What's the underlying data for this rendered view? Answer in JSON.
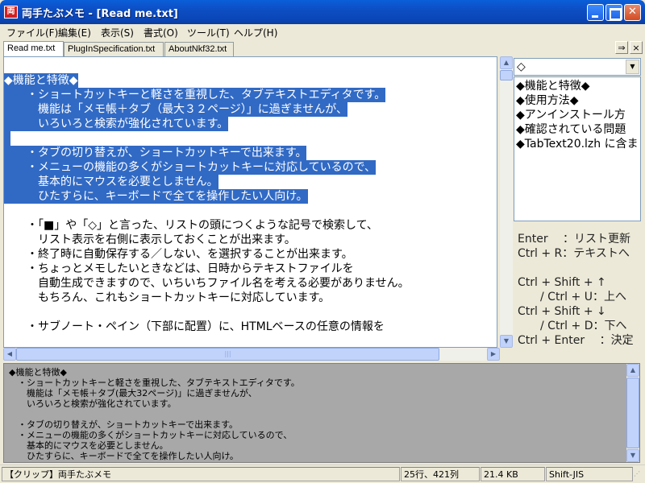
{
  "window": {
    "title": "両手たぶメモ - [Read me.txt]",
    "icon_text": "両"
  },
  "menu": [
    "ファイル(F)",
    "編集(E)",
    "表示(S)",
    "書式(O)",
    "ツール(T)",
    "ヘルプ(H)"
  ],
  "tabs": [
    {
      "label": "Read me.txt",
      "active": true
    },
    {
      "label": "PlugInSpecification.txt",
      "active": false
    },
    {
      "label": "AboutNkf32.txt",
      "active": false
    }
  ],
  "tab_nav": {
    "right": "⇒",
    "close": "×"
  },
  "editor": {
    "lines": [
      {
        "text": "◆機能と特徴◆",
        "selected": true
      },
      {
        "text": "　　・ショートカットキーと軽さを重視した、タブテキストエディタです。",
        "selected": true
      },
      {
        "text": "　　　機能は「メモ帳＋タブ（最大３２ページ）」に過ぎませんが、",
        "selected": true
      },
      {
        "text": "　　　いろいろと検索が強化されています。",
        "selected": true
      },
      {
        "text": "",
        "selected": false
      },
      {
        "text": "　　・タブの切り替えが、ショートカットキーで出来ます。",
        "selected": true
      },
      {
        "text": "　　・メニューの機能の多くがショートカットキーに対応しているので、",
        "selected": true
      },
      {
        "text": "　　　基本的にマウスを必要としません。",
        "selected": true
      },
      {
        "text": "　　　ひたすらに、キーボードで全てを操作したい人向け。",
        "selected": true
      },
      {
        "text": "",
        "selected": false
      },
      {
        "text": "　　・「■」や「◇」と言った、リストの頭につくような記号で検索して、",
        "selected": false
      },
      {
        "text": "　　　リスト表示を右側に表示しておくことが出来ます。",
        "selected": false
      },
      {
        "text": "　　・終了時に自動保存する／しない、を選択することが出来ます。",
        "selected": false
      },
      {
        "text": "　　・ちょっとメモしたいときなどは、日時からテキストファイルを",
        "selected": false
      },
      {
        "text": "　　　自動生成できますので、いちいちファイル名を考える必要がありません。",
        "selected": false
      },
      {
        "text": "　　　もちろん、これもショートカットキーに対応しています。",
        "selected": false
      },
      {
        "text": "",
        "selected": false
      },
      {
        "text": "　　・サブノート・ペイン（下部に配置）に、HTMLベースの任意の情報を",
        "selected": false
      }
    ],
    "hscroll_grip": "|||"
  },
  "right_pane": {
    "selected_symbol": "◇",
    "list": [
      "◆機能と特徴◆",
      "◆使用方法◆",
      "◆アンインストール方",
      "◆確認されている問題",
      "◆TabText20.lzh に含ま"
    ],
    "help_lines": [
      "Enter 　：リスト更新",
      "Ctrl + R：テキストへ",
      "",
      "Ctrl + Shift + ↑",
      "　　/ Ctrl + U：上へ",
      "Ctrl + Shift + ↓",
      "　　/ Ctrl + D：下へ",
      "Ctrl + Enter 　：決定"
    ]
  },
  "lower_pane": {
    "lines": [
      "◆機能と特徴◆",
      "　・ショートカットキーと軽さを重視した、タブテキストエディタです。",
      "　　機能は「メモ帳＋タブ(最大32ページ)」に過ぎませんが、",
      "　　いろいろと検索が強化されています。",
      "",
      "　・タブの切り替えが、ショートカットキーで出来ます。",
      "　・メニューの機能の多くがショートカットキーに対応しているので、",
      "　　基本的にマウスを必要としません。",
      "　　ひたすらに、キーボードで全てを操作したい人向け。"
    ]
  },
  "status": {
    "clip": "【クリップ】両手たぶメモ",
    "position": "25行、421列",
    "size": "21.4 KB",
    "encoding": "Shift-JIS"
  },
  "colors": {
    "selection": "#316ac5",
    "titlebar": "#0a5fd8",
    "lower_bg": "#a8a8a8"
  }
}
